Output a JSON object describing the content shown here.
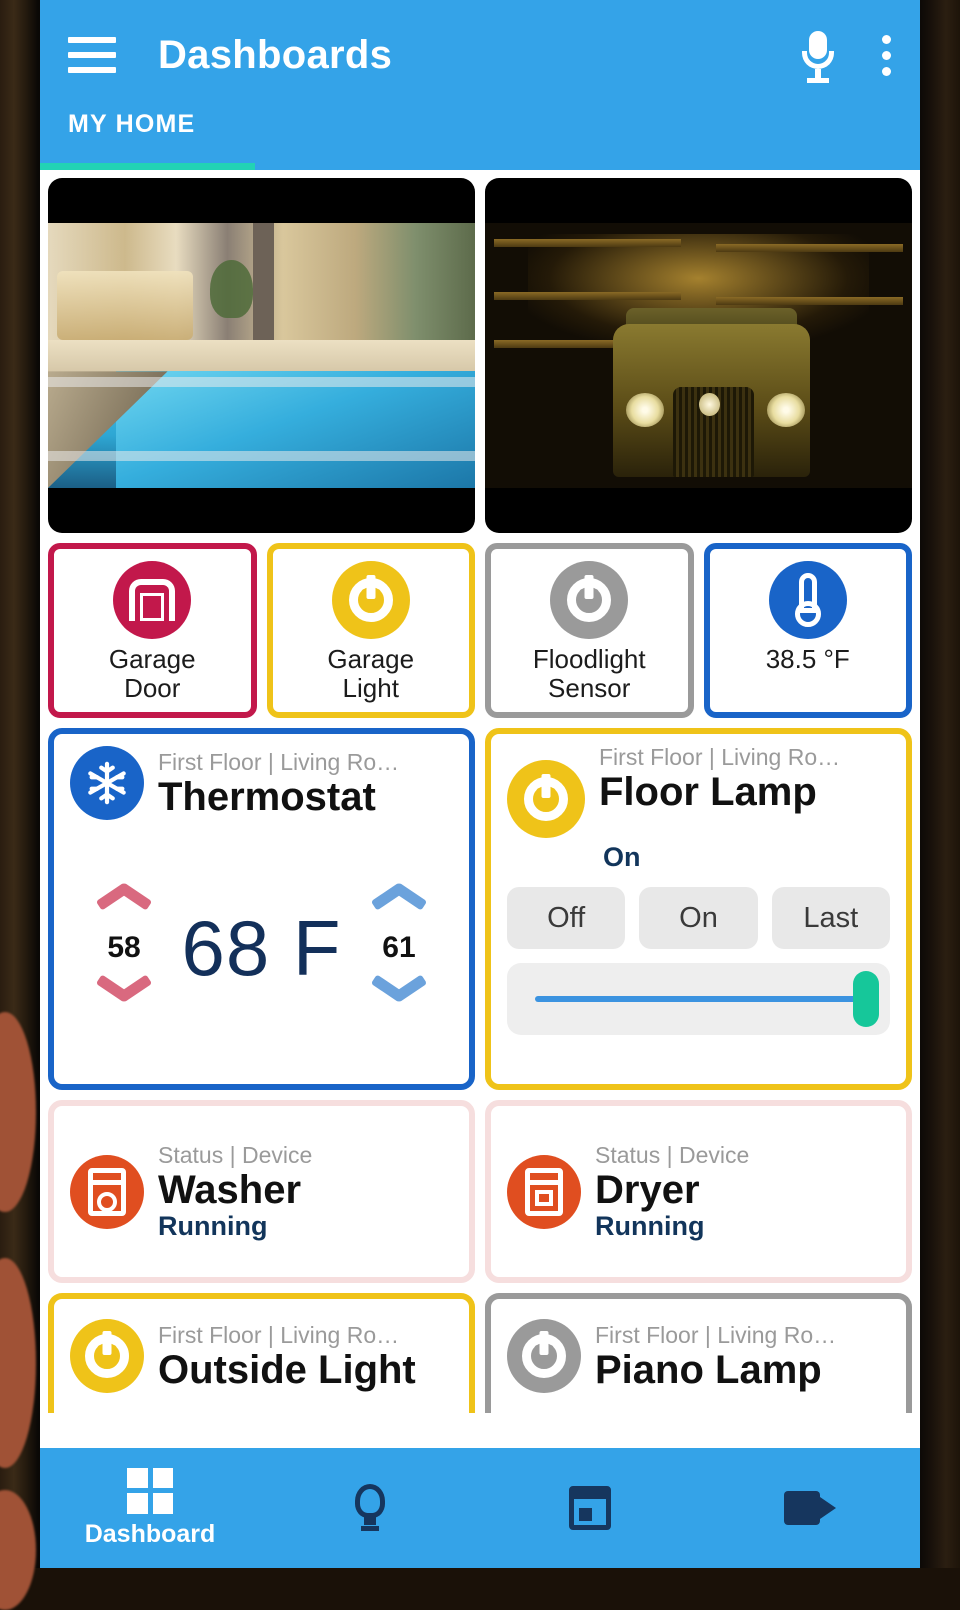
{
  "appbar": {
    "title": "Dashboards",
    "menu_icon": "hamburger-menu-icon",
    "mic_icon": "microphone-icon",
    "overflow_icon": "overflow-menu-icon",
    "tab_label": "MY HOME",
    "accent_color": "#34a3e8",
    "indicator_color": "#22d3b4"
  },
  "cameras": [
    {
      "name": "indoor-pool-camera"
    },
    {
      "name": "garage-workshop-camera"
    }
  ],
  "shortcuts": [
    {
      "label_line1": "Garage",
      "label_line2": "Door",
      "icon": "garage-door-icon",
      "color": "#C2184B"
    },
    {
      "label_line1": "Garage",
      "label_line2": "Light",
      "icon": "power-icon",
      "color": "#EFC319"
    },
    {
      "label_line1": "Floodlight",
      "label_line2": "Sensor",
      "icon": "power-icon",
      "color": "#9a9a9a"
    },
    {
      "label_line1": "38.5 °F",
      "label_line2": "",
      "icon": "thermometer-icon",
      "color": "#1964c8"
    }
  ],
  "thermostat": {
    "subtitle": "First Floor | Living Ro…",
    "title": "Thermostat",
    "icon": "snowflake-icon",
    "current": "68 F",
    "heat_setpoint": "58",
    "cool_setpoint": "61",
    "border_color": "#1964c8",
    "heat_arrow_color": "#d9697f",
    "cool_arrow_color": "#6ba2dc"
  },
  "floorlamp": {
    "subtitle": "First Floor | Living Ro…",
    "title": "Floor Lamp",
    "icon": "power-icon",
    "state": "On",
    "buttons": [
      "Off",
      "On",
      "Last"
    ],
    "slider_percent": 97,
    "border_color": "#EFC319",
    "slider_track_color": "#3b93e0",
    "slider_thumb_color": "#16c79a"
  },
  "appliances": [
    {
      "subtitle": "Status | Device",
      "title": "Washer",
      "state": "Running",
      "icon": "washer-icon",
      "color": "#e04e20"
    },
    {
      "subtitle": "Status | Device",
      "title": "Dryer",
      "state": "Running",
      "icon": "dryer-icon",
      "color": "#e04e20"
    }
  ],
  "lights": [
    {
      "subtitle": "First Floor | Living Ro…",
      "title": "Outside Light",
      "icon": "power-icon",
      "color": "#EFC319",
      "border_color": "#EFC319"
    },
    {
      "subtitle": "First Floor | Living Ro…",
      "title": "Piano Lamp",
      "icon": "power-icon",
      "color": "#9a9a9a",
      "border_color": "#9a9a9a"
    }
  ],
  "bottomnav": [
    {
      "label": "Dashboard",
      "icon": "dashboard-grid-icon",
      "active": true
    },
    {
      "label": "",
      "icon": "lightbulb-icon",
      "active": false
    },
    {
      "label": "",
      "icon": "calendar-icon",
      "active": false
    },
    {
      "label": "",
      "icon": "video-camera-icon",
      "active": false
    }
  ]
}
